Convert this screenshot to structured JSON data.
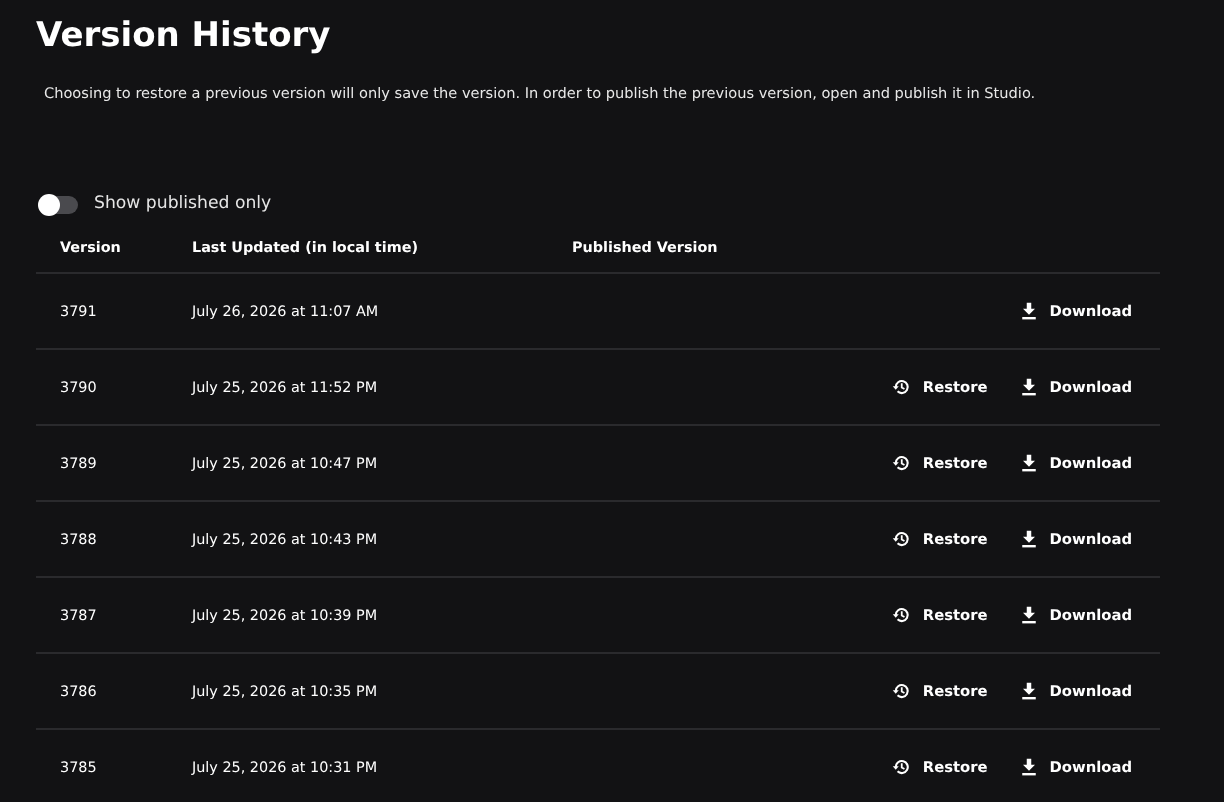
{
  "title": "Version History",
  "description": "Choosing to restore a previous version will only save the version. In order to publish the previous version, open and publish it in Studio.",
  "toggle": {
    "label": "Show published only",
    "on": false
  },
  "table": {
    "columns": [
      "Version",
      "Last Updated (in local time)",
      "Published Version"
    ],
    "rows": [
      {
        "version": "3791",
        "updated": "July 26, 2026 at 11:07 AM",
        "restore": null,
        "download": "Download"
      },
      {
        "version": "3790",
        "updated": "July 25, 2026 at 11:52 PM",
        "restore": "Restore",
        "download": "Download"
      },
      {
        "version": "3789",
        "updated": "July 25, 2026 at 10:47 PM",
        "restore": "Restore",
        "download": "Download"
      },
      {
        "version": "3788",
        "updated": "July 25, 2026 at 10:43 PM",
        "restore": "Restore",
        "download": "Download"
      },
      {
        "version": "3787",
        "updated": "July 25, 2026 at 10:39 PM",
        "restore": "Restore",
        "download": "Download"
      },
      {
        "version": "3786",
        "updated": "July 25, 2026 at 10:35 PM",
        "restore": "Restore",
        "download": "Download"
      },
      {
        "version": "3785",
        "updated": "July 25, 2026 at 10:31 PM",
        "restore": "Restore",
        "download": "Download"
      }
    ]
  }
}
